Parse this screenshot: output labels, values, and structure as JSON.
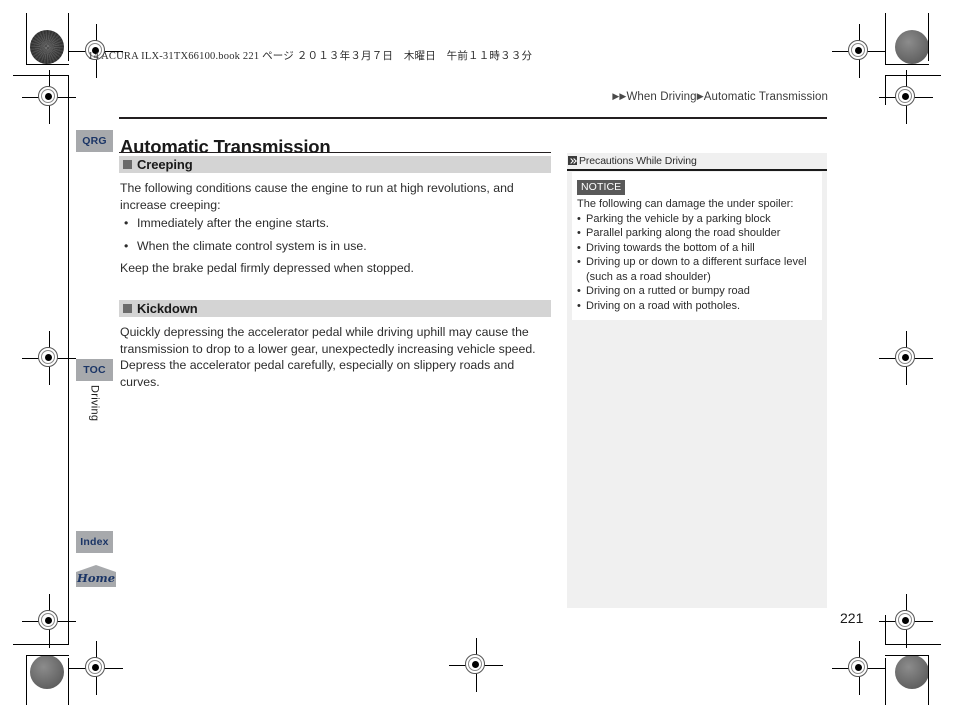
{
  "print_marks": {
    "file_slug": "14 ACURA ILX-31TX66100.book  221 ページ  ２０１３年３月７日　木曜日　午前１１時３３分"
  },
  "breadcrumb": {
    "arrow_double": "▶▶",
    "arrow_single": "▶",
    "section": "When Driving",
    "topic": "Automatic Transmission"
  },
  "page_title": "Automatic Transmission",
  "left_nav": {
    "qrg_label": "QRG",
    "toc_label": "TOC",
    "index_label": "Index",
    "home_label": "Home",
    "chapter_label": "Driving"
  },
  "sections": [
    {
      "heading": "Creeping",
      "intro": "The following conditions cause the engine to run at high revolutions, and increase creeping:",
      "bullets": [
        "Immediately after the engine starts.",
        "When the climate control system is in use."
      ],
      "outro": "Keep the brake pedal firmly depressed when stopped."
    },
    {
      "heading": "Kickdown",
      "body": "Quickly depressing the accelerator pedal while driving uphill may cause the transmission to drop to a lower gear, unexpectedly increasing vehicle speed. Depress the accelerator pedal carefully, especially on slippery roads and curves."
    }
  ],
  "side_panel": {
    "title": "Precautions While Driving",
    "notice_badge": "NOTICE",
    "notice_lead": "The following can damage the under spoiler:",
    "notice_items": [
      {
        "text": "Parking the vehicle by a parking block",
        "continuation": false
      },
      {
        "text": "Parallel parking along the road shoulder",
        "continuation": false
      },
      {
        "text": "Driving towards the bottom of a hill",
        "continuation": false
      },
      {
        "text": "Driving up or down to a different surface level",
        "continuation": false
      },
      {
        "text": "(such as a road shoulder)",
        "continuation": true
      },
      {
        "text": "Driving on a rutted or bumpy road",
        "continuation": false
      },
      {
        "text": "Driving on a road with potholes.",
        "continuation": false
      }
    ],
    "bullet_glyph": "•"
  },
  "bullet_glyph": "•",
  "page_number": "221",
  "colors": {
    "tab_gray": "#a7a9ac",
    "tab_text_blue": "#1b3566",
    "section_bar_gray": "#d4d4d4",
    "panel_gray": "#f0f0f0",
    "notice_badge_gray": "#595959",
    "text": "#2c2c2c"
  }
}
